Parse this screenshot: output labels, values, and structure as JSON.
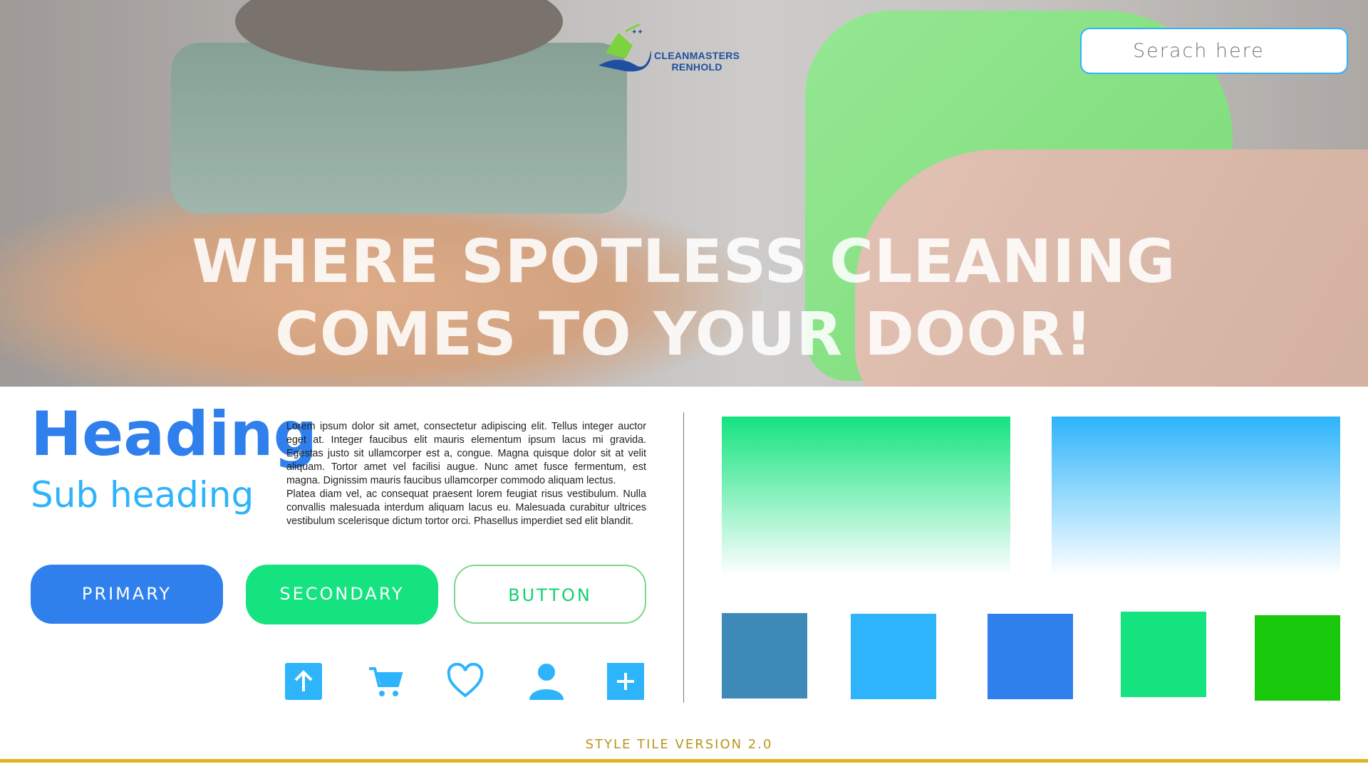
{
  "brand": {
    "name_line1": "CLEANMASTERS",
    "name_line2": "RENHOLD"
  },
  "search": {
    "placeholder": "Serach here"
  },
  "hero": {
    "line1": "WHERE SPOTLESS CLEANING",
    "line2": "COMES TO YOUR DOOR!"
  },
  "typography": {
    "heading": "Heading",
    "subheading": "Sub heading",
    "paragraph1": "Lorem ipsum dolor sit amet, consectetur adipiscing elit. Tellus integer auctor eget at. Integer faucibus elit mauris elementum ipsum lacus mi gravida. Egestas justo sit ullamcorper est a, congue. Magna quisque dolor sit at velit aliquam. Tortor amet vel facilisi augue. Nunc amet fusce fermentum, est magna. Dignissim mauris faucibus ullamcorper commodo aliquam lectus.",
    "paragraph2": "Platea diam vel, ac consequat praesent lorem feugiat risus vestibulum. Nulla convallis malesuada interdum aliquam lacus eu. Malesuada curabitur ultrices vestibulum scelerisque dictum tortor orci. Phasellus imperdiet sed elit blandit."
  },
  "buttons": {
    "primary": "PRIMARY",
    "secondary": "SECONDARY",
    "outline": "BUTTON"
  },
  "icons": [
    "upload-icon",
    "cart-icon",
    "heart-icon",
    "user-icon",
    "plus-icon"
  ],
  "gradients": [
    "#14e37f",
    "#2eb4fb"
  ],
  "swatches": [
    "#3d8ab8",
    "#2eb4fb",
    "#2f80ed",
    "#14e37f",
    "#18c80a"
  ],
  "footer": {
    "label": "STYLE TILE VERSION 2.0"
  }
}
